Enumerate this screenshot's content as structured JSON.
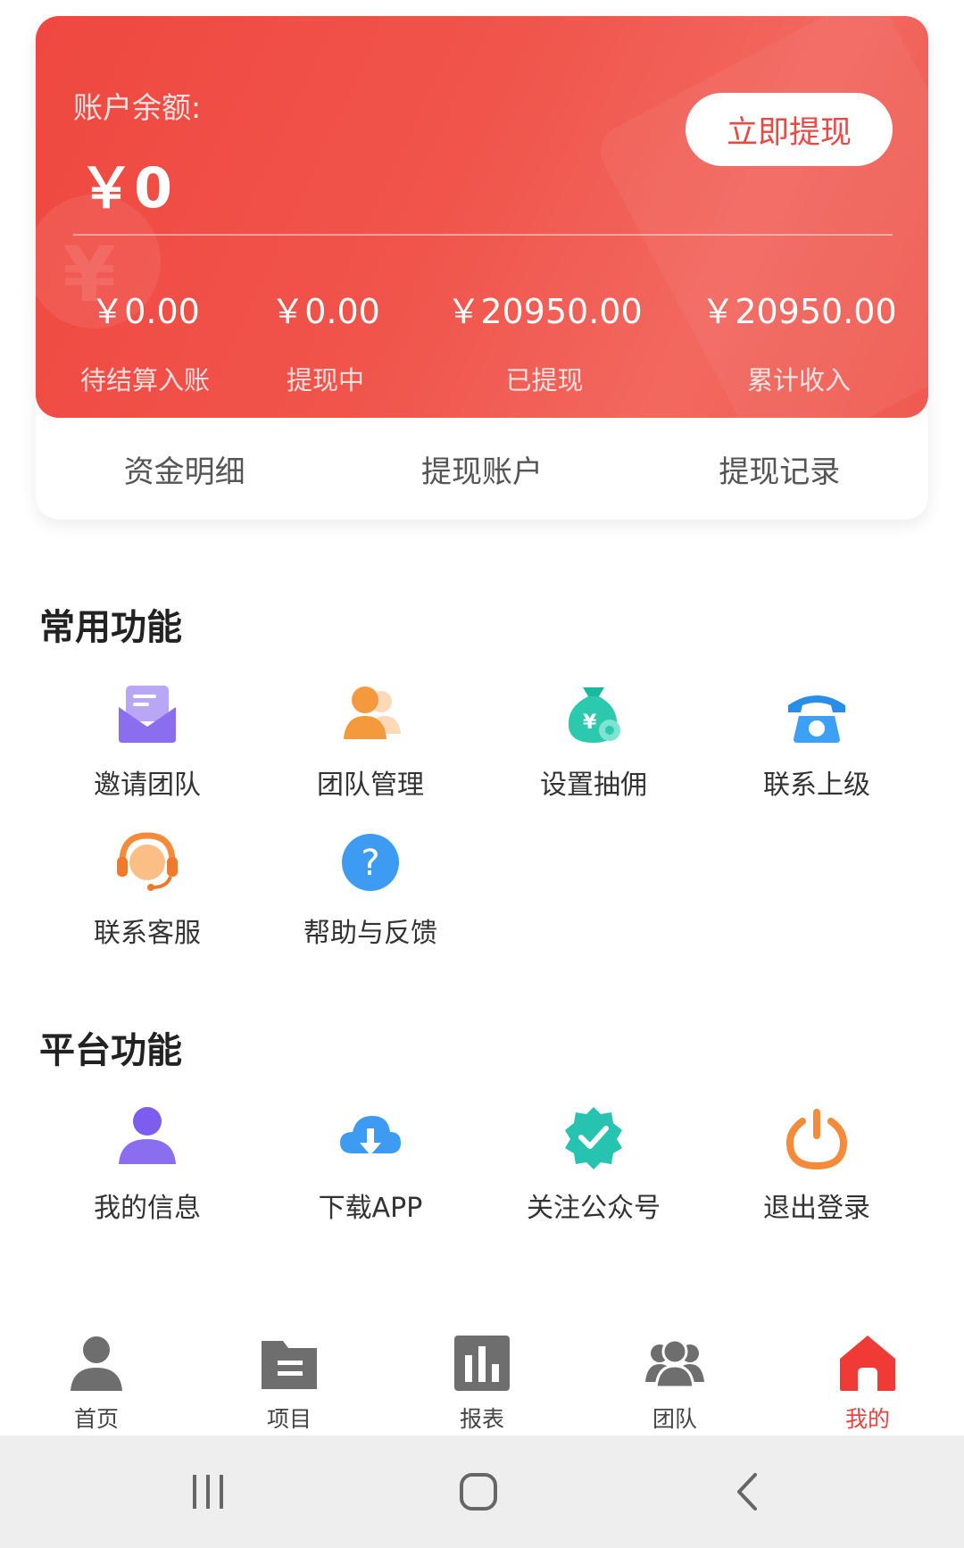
{
  "account": {
    "balance_label": "账户余额:",
    "balance_value": "￥0",
    "withdraw_button": "立即提现",
    "stats": [
      {
        "amount": "￥0.00",
        "label": "待结算入账"
      },
      {
        "amount": "￥0.00",
        "label": "提现中"
      },
      {
        "amount": "￥20950.00",
        "label": "已提现"
      },
      {
        "amount": "￥20950.00",
        "label": "累计收入"
      }
    ],
    "tabs": [
      "资金明细",
      "提现账户",
      "提现记录"
    ]
  },
  "common_functions": {
    "title": "常用功能",
    "items": [
      {
        "label": "邀请团队",
        "icon": "envelope-icon"
      },
      {
        "label": "团队管理",
        "icon": "team-manage-icon"
      },
      {
        "label": "设置抽佣",
        "icon": "money-bag-gear-icon"
      },
      {
        "label": "联系上级",
        "icon": "telephone-icon"
      },
      {
        "label": "联系客服",
        "icon": "headset-icon"
      },
      {
        "label": "帮助与反馈",
        "icon": "help-question-icon"
      }
    ]
  },
  "platform_functions": {
    "title": "平台功能",
    "items": [
      {
        "label": "我的信息",
        "icon": "user-icon"
      },
      {
        "label": "下载APP",
        "icon": "cloud-download-icon"
      },
      {
        "label": "关注公众号",
        "icon": "verified-badge-icon"
      },
      {
        "label": "退出登录",
        "icon": "power-icon"
      }
    ]
  },
  "bottom_nav": {
    "items": [
      {
        "label": "首页",
        "icon": "person-icon"
      },
      {
        "label": "项目",
        "icon": "folder-icon"
      },
      {
        "label": "报表",
        "icon": "bar-chart-icon"
      },
      {
        "label": "团队",
        "icon": "group-icon"
      },
      {
        "label": "我的",
        "icon": "home-icon",
        "active": true
      }
    ]
  },
  "colors": {
    "accent": "#e8463f",
    "card_gradient_start": "#ef4840",
    "card_gradient_end": "#f2685f"
  }
}
